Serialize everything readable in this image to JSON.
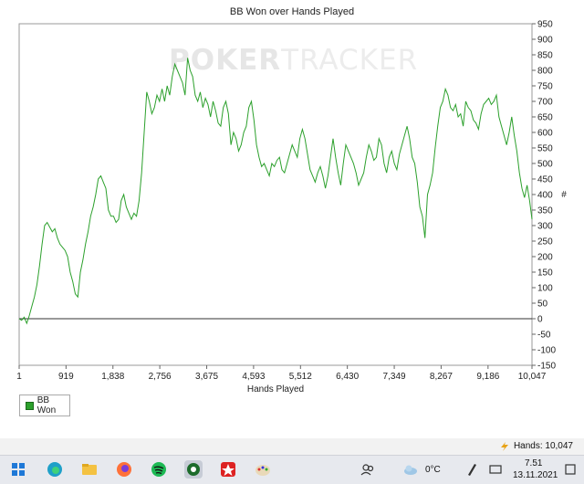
{
  "chart_data": {
    "type": "line",
    "title": "BB Won over Hands Played",
    "xlabel": "Hands Played",
    "ylabel": "",
    "xlim": [
      1,
      10047
    ],
    "ylim": [
      -150,
      950
    ],
    "x_ticks": [
      "1",
      "919",
      "1,838",
      "2,756",
      "3,675",
      "4,593",
      "5,512",
      "6,430",
      "7,349",
      "8,267",
      "9,186",
      "10,047"
    ],
    "y_ticks": [
      "950",
      "900",
      "850",
      "800",
      "750",
      "700",
      "650",
      "600",
      "550",
      "500",
      "450",
      "400",
      "350",
      "300",
      "250",
      "200",
      "150",
      "100",
      "50",
      "0",
      "-50",
      "-100",
      "-150"
    ],
    "y_axis_symbol": "#",
    "watermark": "POKERTRACKER",
    "series": [
      {
        "name": "BB Won",
        "color": "#2ca02c",
        "x": [
          1,
          50,
          100,
          150,
          200,
          250,
          300,
          350,
          400,
          450,
          500,
          550,
          600,
          650,
          700,
          750,
          800,
          850,
          900,
          950,
          1000,
          1050,
          1100,
          1150,
          1200,
          1250,
          1300,
          1350,
          1400,
          1450,
          1500,
          1550,
          1600,
          1650,
          1700,
          1750,
          1800,
          1850,
          1900,
          1950,
          2000,
          2050,
          2100,
          2150,
          2200,
          2250,
          2300,
          2350,
          2400,
          2450,
          2500,
          2550,
          2600,
          2650,
          2700,
          2750,
          2800,
          2850,
          2900,
          2950,
          3000,
          3050,
          3100,
          3150,
          3200,
          3250,
          3300,
          3350,
          3400,
          3450,
          3500,
          3550,
          3600,
          3650,
          3700,
          3750,
          3800,
          3850,
          3900,
          3950,
          4000,
          4050,
          4100,
          4150,
          4200,
          4250,
          4300,
          4350,
          4400,
          4450,
          4500,
          4550,
          4600,
          4650,
          4700,
          4750,
          4800,
          4850,
          4900,
          4950,
          5000,
          5050,
          5100,
          5150,
          5200,
          5250,
          5300,
          5350,
          5400,
          5450,
          5500,
          5550,
          5600,
          5650,
          5700,
          5750,
          5800,
          5850,
          5900,
          5950,
          6000,
          6050,
          6100,
          6150,
          6200,
          6250,
          6300,
          6350,
          6400,
          6450,
          6500,
          6550,
          6600,
          6650,
          6700,
          6750,
          6800,
          6850,
          6900,
          6950,
          7000,
          7050,
          7100,
          7150,
          7200,
          7250,
          7300,
          7350,
          7400,
          7450,
          7500,
          7550,
          7600,
          7650,
          7700,
          7750,
          7800,
          7850,
          7900,
          7950,
          8000,
          8050,
          8100,
          8150,
          8200,
          8250,
          8300,
          8350,
          8400,
          8450,
          8500,
          8550,
          8600,
          8650,
          8700,
          8750,
          8800,
          8850,
          8900,
          8950,
          9000,
          9050,
          9100,
          9150,
          9200,
          9250,
          9300,
          9350,
          9400,
          9450,
          9500,
          9550,
          9600,
          9650,
          9700,
          9750,
          9800,
          9850,
          9900,
          9950,
          10000,
          10047
        ],
        "y": [
          0,
          -5,
          5,
          -15,
          10,
          40,
          70,
          110,
          170,
          240,
          300,
          310,
          295,
          280,
          290,
          260,
          240,
          230,
          220,
          200,
          150,
          120,
          80,
          70,
          150,
          190,
          240,
          280,
          330,
          360,
          400,
          450,
          460,
          440,
          420,
          350,
          330,
          330,
          310,
          320,
          380,
          400,
          360,
          340,
          320,
          340,
          330,
          380,
          470,
          600,
          730,
          700,
          660,
          680,
          720,
          700,
          740,
          700,
          750,
          720,
          780,
          820,
          800,
          780,
          760,
          720,
          840,
          800,
          780,
          720,
          700,
          730,
          680,
          710,
          690,
          650,
          700,
          670,
          630,
          620,
          680,
          700,
          660,
          560,
          600,
          580,
          540,
          560,
          600,
          620,
          680,
          700,
          640,
          560,
          520,
          490,
          500,
          480,
          460,
          500,
          490,
          510,
          520,
          480,
          470,
          500,
          530,
          560,
          540,
          520,
          580,
          610,
          580,
          530,
          480,
          460,
          440,
          470,
          490,
          460,
          420,
          460,
          520,
          580,
          520,
          470,
          430,
          500,
          560,
          540,
          520,
          500,
          470,
          430,
          450,
          470,
          520,
          560,
          540,
          510,
          520,
          580,
          560,
          500,
          470,
          520,
          540,
          500,
          480,
          530,
          560,
          590,
          620,
          580,
          520,
          500,
          440,
          360,
          330,
          260,
          400,
          430,
          470,
          550,
          620,
          680,
          700,
          740,
          720,
          680,
          670,
          690,
          650,
          660,
          620,
          700,
          680,
          670,
          640,
          630,
          610,
          660,
          690,
          700,
          710,
          690,
          700,
          720,
          650,
          620,
          590,
          560,
          600,
          650,
          590,
          540,
          470,
          420,
          390,
          430,
          380,
          320
        ]
      }
    ]
  },
  "legend": {
    "label": "BB Won"
  },
  "status": {
    "hands_label": "Hands: 10,047"
  },
  "taskbar": {
    "temperature": "0°C",
    "time": "7.51",
    "date": "13.11.2021"
  }
}
